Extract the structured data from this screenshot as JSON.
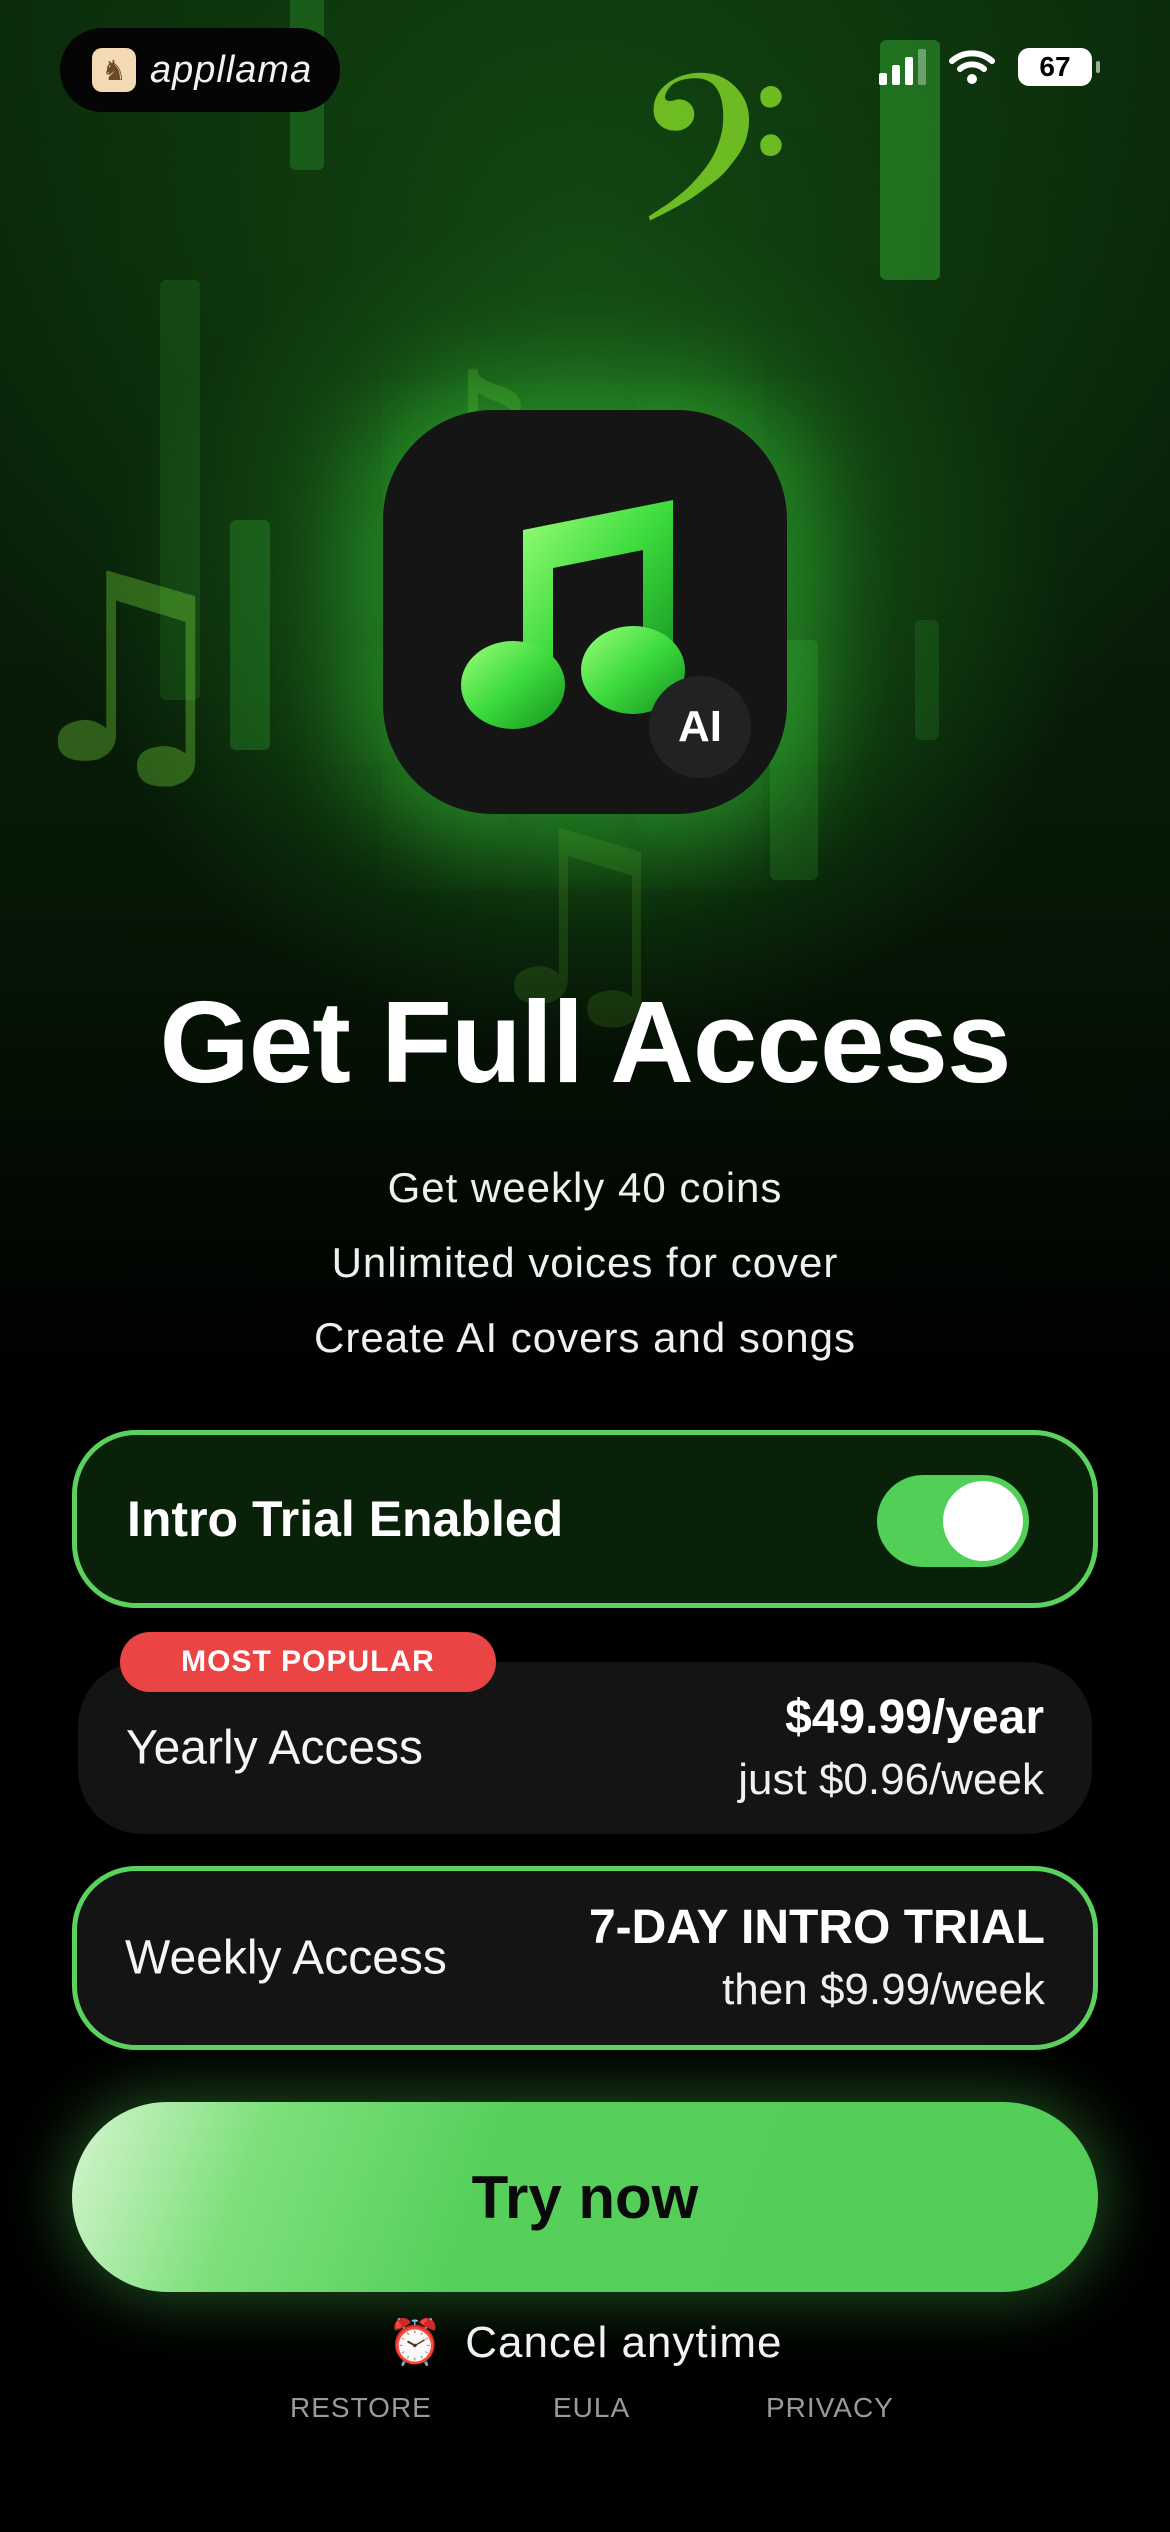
{
  "status_bar": {
    "brand": "appllama",
    "battery": "67"
  },
  "app_icon": {
    "badge": "AI"
  },
  "title": "Get Full Access",
  "features": [
    "Get weekly 40 coins",
    "Unlimited voices for cover",
    "Create AI covers and songs"
  ],
  "trial_toggle": {
    "label": "Intro Trial Enabled",
    "enabled": true
  },
  "plans": [
    {
      "badge": "MOST POPULAR",
      "name": "Yearly Access",
      "price": "$49.99/year",
      "detail": "just $0.96/week",
      "selected": false
    },
    {
      "name": "Weekly Access",
      "price": "7-DAY INTRO TRIAL",
      "detail": "then $9.99/week",
      "selected": true
    }
  ],
  "cta_label": "Try now",
  "cancel_text": "Cancel anytime",
  "footer": {
    "restore": "RESTORE",
    "eula": "EULA",
    "privacy": "PRIVACY"
  },
  "colors": {
    "accent": "#52cd57",
    "badge": "#ea4444",
    "background": "#000000"
  }
}
